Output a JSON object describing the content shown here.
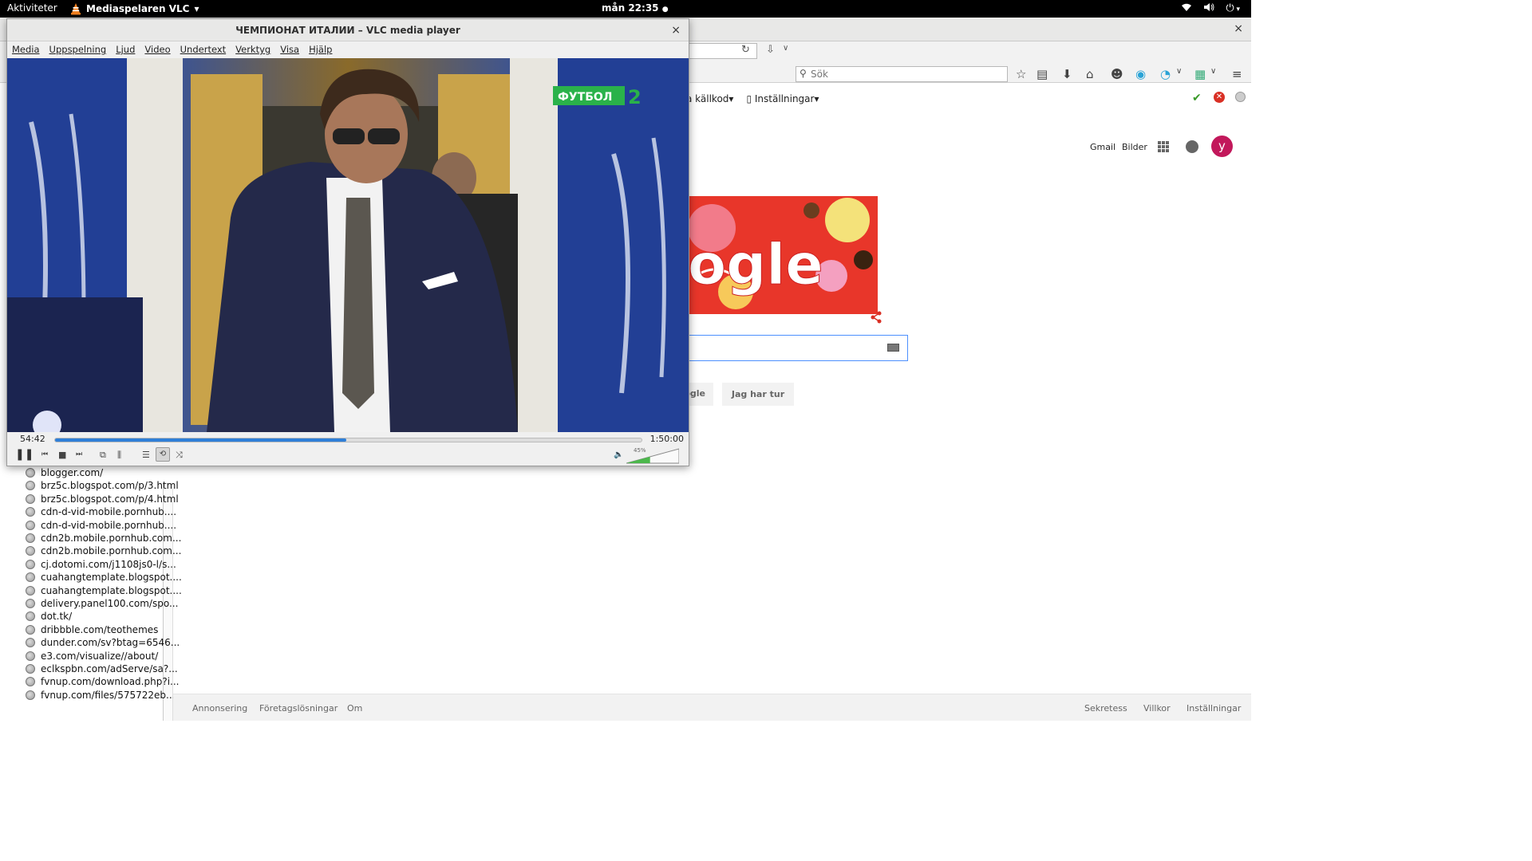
{
  "topbar": {
    "activities": "Aktiviteter",
    "app_name": "Mediaspelaren VLC",
    "clock": "mån 22:35",
    "icons": [
      "wifi-icon",
      "volume-icon",
      "power-icon"
    ]
  },
  "firefox": {
    "close": "×",
    "search_placeholder": "Sök",
    "bookmarks": [
      "a källkod",
      "Inställningar"
    ]
  },
  "google": {
    "gmail": "Gmail",
    "images": "Bilder",
    "avatar_letter": "y",
    "doodle_text": "ogle",
    "btn_search_partial": "ogle",
    "btn_lucky": "Jag har tur",
    "footer_left": [
      "Annonsering",
      "Företagslösningar",
      "Om"
    ],
    "footer_right": [
      "Sekretess",
      "Villkor",
      "Inställningar"
    ]
  },
  "sidebar": {
    "history": [
      "blogger.com/",
      "brz5c.blogspot.com/p/3.html",
      "brz5c.blogspot.com/p/4.html",
      "cdn-d-vid-mobile.pornhub....",
      "cdn-d-vid-mobile.pornhub....",
      "cdn2b.mobile.pornhub.com...",
      "cdn2b.mobile.pornhub.com...",
      "cj.dotomi.com/j1108js0-l/s...",
      "cuahangtemplate.blogspot....",
      "cuahangtemplate.blogspot....",
      "delivery.panel100.com/spo...",
      "dot.tk/",
      "dribbble.com/teothemes",
      "dunder.com/sv?btag=6546...",
      "e3.com/visualize//about/",
      "eclkspbn.com/adServe/sa?...",
      "fvnup.com/download.php?i...",
      "fvnup.com/files/575722eb..."
    ]
  },
  "vlc": {
    "title": "ЧЕМПИОНАТ ИТАЛИИ – VLC media player",
    "close": "×",
    "menu": [
      "Media",
      "Uppspelning",
      "Ljud",
      "Video",
      "Undertext",
      "Verktyg",
      "Visa",
      "Hjälp"
    ],
    "channel_logo": "ФУТБОЛ",
    "channel_num": "2",
    "elapsed": "54:42",
    "total": "1:50:00",
    "progress": 0.497,
    "volume_label": "45%",
    "volume": 0.45
  }
}
